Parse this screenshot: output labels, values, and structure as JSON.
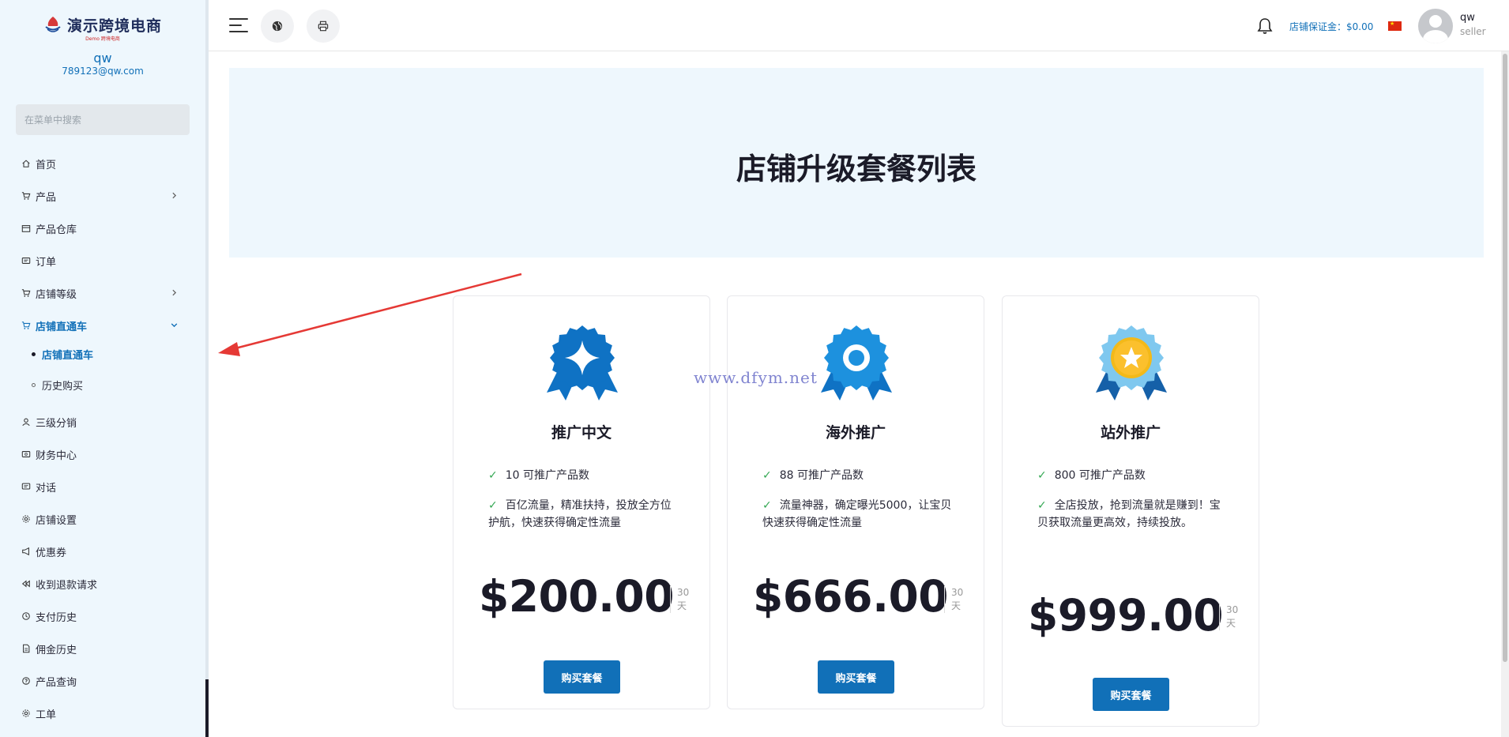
{
  "brand": {
    "name": "演示跨境电商",
    "sub": "Demo 跨境电商"
  },
  "user": {
    "name": "qw",
    "email": "789123@qw.com",
    "role": "seller"
  },
  "sidebar": {
    "search_placeholder": "在菜单中搜索",
    "items": [
      {
        "label": "首页",
        "icon": "home-icon"
      },
      {
        "label": "产品",
        "icon": "cart-icon",
        "chevron": true
      },
      {
        "label": "产品仓库",
        "icon": "warehouse-icon"
      },
      {
        "label": "订单",
        "icon": "order-icon"
      },
      {
        "label": "店铺等级",
        "icon": "cart-icon",
        "chevron": true
      },
      {
        "label": "店铺直通车",
        "icon": "cart-icon",
        "chevron": true,
        "expanded": true,
        "active": true
      },
      {
        "label": "三级分销",
        "icon": "user-icon"
      },
      {
        "label": "财务中心",
        "icon": "finance-icon"
      },
      {
        "label": "对话",
        "icon": "chat-icon"
      },
      {
        "label": "店铺设置",
        "icon": "gear-icon"
      },
      {
        "label": "优惠券",
        "icon": "megaphone-icon"
      },
      {
        "label": "收到退款请求",
        "icon": "rewind-icon"
      },
      {
        "label": "支付历史",
        "icon": "history-icon"
      },
      {
        "label": "佣金历史",
        "icon": "document-icon"
      },
      {
        "label": "产品查询",
        "icon": "help-icon"
      },
      {
        "label": "工单",
        "icon": "gear-icon"
      }
    ],
    "subitems": [
      {
        "label": "店铺直通车",
        "active": true
      },
      {
        "label": "历史购买",
        "active": false
      }
    ]
  },
  "header": {
    "deposit_label": "店铺保证金：$0.00",
    "flag": "china-flag-icon"
  },
  "page": {
    "title": "店铺升级套餐列表"
  },
  "packages": [
    {
      "name": "推广中文",
      "features": [
        "10 可推广产品数",
        "百亿流量，精准扶持，投放全方位护航，快速获得确定性流量"
      ],
      "price": "$200.00",
      "period_num": "30",
      "period_unit": "天",
      "button": "购买套餐",
      "badge": "diamond-badge-icon"
    },
    {
      "name": "海外推广",
      "features": [
        "88 可推广产品数",
        "流量神器，确定曝光5000，让宝贝快速获得确定性流量"
      ],
      "price": "$666.00",
      "period_num": "30",
      "period_unit": "天",
      "button": "购买套餐",
      "badge": "circle-badge-icon"
    },
    {
      "name": "站外推广",
      "features": [
        "800 可推广产品数",
        "全店投放，抢到流量就是赚到！宝贝获取流量更高效，持续投放。"
      ],
      "price": "$999.00",
      "period_num": "30",
      "period_unit": "天",
      "button": "购买套餐",
      "badge": "star-badge-icon"
    }
  ],
  "watermark": "www.dfym.net",
  "colors": {
    "accent": "#1170b8",
    "sidebar_bg": "#eef7fd",
    "banner_bg": "#eef7fd",
    "check": "#34a853",
    "arrow": "#e53935"
  }
}
